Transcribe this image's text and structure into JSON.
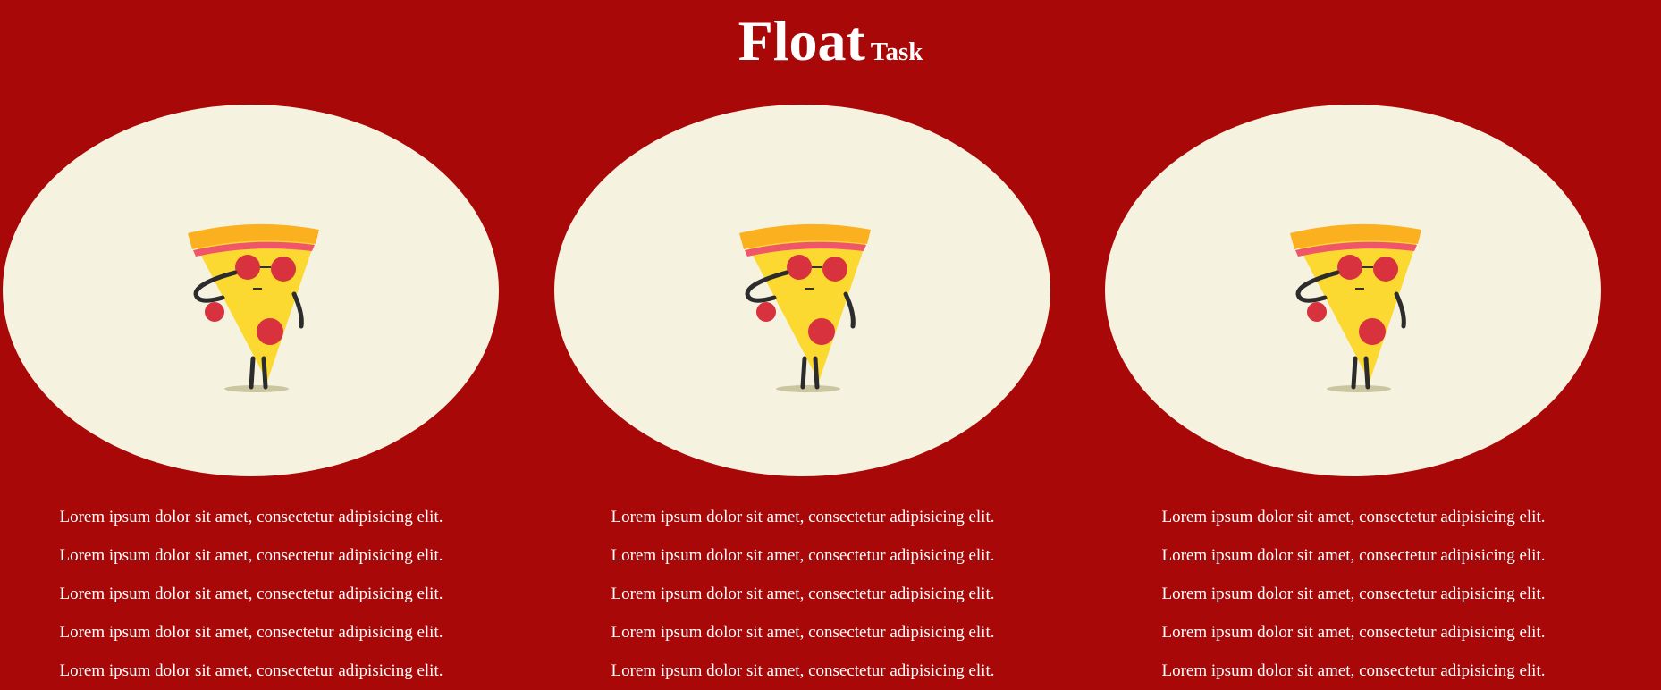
{
  "page": {
    "title_main": "Float",
    "title_sub": "Task"
  },
  "colors": {
    "background": "#a80808",
    "ellipse_fill": "#f6f2e0",
    "text": "#ffffff"
  },
  "columns": [
    {
      "image_icon": "pizza-slice-sunglasses-icon",
      "lines": [
        "Lorem ipsum dolor sit amet, consectetur adipisicing elit.",
        "Lorem ipsum dolor sit amet, consectetur adipisicing elit.",
        "Lorem ipsum dolor sit amet, consectetur adipisicing elit.",
        "Lorem ipsum dolor sit amet, consectetur adipisicing elit.",
        "Lorem ipsum dolor sit amet, consectetur adipisicing elit."
      ]
    },
    {
      "image_icon": "pizza-slice-sunglasses-icon",
      "lines": [
        "Lorem ipsum dolor sit amet, consectetur adipisicing elit.",
        "Lorem ipsum dolor sit amet, consectetur adipisicing elit.",
        "Lorem ipsum dolor sit amet, consectetur adipisicing elit.",
        "Lorem ipsum dolor sit amet, consectetur adipisicing elit.",
        "Lorem ipsum dolor sit amet, consectetur adipisicing elit."
      ]
    },
    {
      "image_icon": "pizza-slice-sunglasses-icon",
      "lines": [
        "Lorem ipsum dolor sit amet, consectetur adipisicing elit.",
        "Lorem ipsum dolor sit amet, consectetur adipisicing elit.",
        "Lorem ipsum dolor sit amet, consectetur adipisicing elit.",
        "Lorem ipsum dolor sit amet, consectetur adipisicing elit.",
        "Lorem ipsum dolor sit amet, consectetur adipisicing elit."
      ]
    }
  ]
}
